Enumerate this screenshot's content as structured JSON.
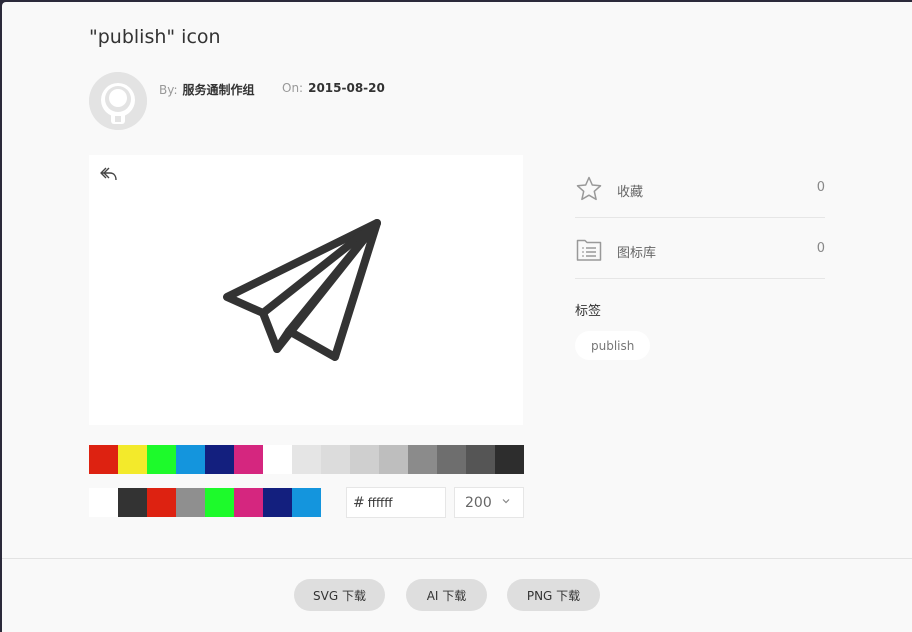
{
  "header": {
    "title": "\"publish\" icon",
    "by_label": "By:",
    "author": "服务通制作组",
    "on_label": "On:",
    "date": "2015-08-20"
  },
  "preview": {
    "icon": "paper-plane-icon",
    "icon_color": "#333333"
  },
  "palette_main": [
    "#dd2211",
    "#f3ea2b",
    "#1dfa2b",
    "#1495dd",
    "#131f7e",
    "#d5267f",
    "#ffffff",
    "#e5e5e5",
    "#dcdcdc",
    "#cfcfcf",
    "#bebebe",
    "#8b8b8b",
    "#6e6e6e",
    "#555555",
    "#2d2d2d"
  ],
  "palette_recent": [
    "#ffffff",
    "#333333",
    "#dd2211",
    "#8f8f8f",
    "#1dfa2b",
    "#d5267f",
    "#131f7e",
    "#1495dd"
  ],
  "color_input": {
    "hash": "#",
    "value": "ffffff"
  },
  "size_select": {
    "value": "200"
  },
  "sidebar": {
    "favorite": {
      "label": "收藏",
      "count": "0",
      "icon": "star-icon"
    },
    "library": {
      "label": "图标库",
      "count": "0",
      "icon": "folder-list-icon"
    },
    "tags_title": "标签",
    "tags": [
      "publish"
    ]
  },
  "footer": {
    "svg_download": "SVG 下载",
    "ai_download": "AI 下载",
    "png_download": "PNG 下载"
  }
}
